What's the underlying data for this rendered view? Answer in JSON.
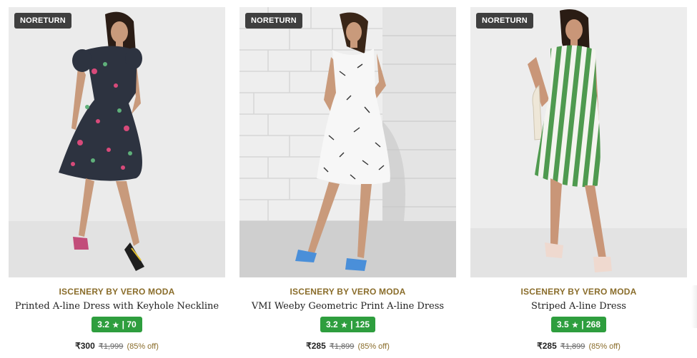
{
  "products": [
    {
      "badge": "NORETURN",
      "brand": "ISCENERY BY VERO MODA",
      "name": "Printed A-line Dress with Keyhole Neckline",
      "rating": "3.2",
      "rating_star": "★",
      "rating_count": "70",
      "price": "₹300",
      "mrp": "₹1,999",
      "discount": "(85% off)"
    },
    {
      "badge": "NORETURN",
      "brand": "ISCENERY BY VERO MODA",
      "name": "VMI Weeby Geometric Print A-line Dress",
      "rating": "3.2",
      "rating_star": "★",
      "rating_count": "125",
      "price": "₹285",
      "mrp": "₹1,899",
      "discount": "(85% off)"
    },
    {
      "badge": "NORETURN",
      "brand": "ISCENERY BY VERO MODA",
      "name": "Striped A-line Dress",
      "rating": "3.5",
      "rating_star": "★",
      "rating_count": "268",
      "price": "₹285",
      "mrp": "₹1,899",
      "discount": "(85% off)"
    }
  ],
  "colors": {
    "brand_text": "#8a6d2b",
    "rating_badge": "#2e9e3e",
    "badge_bg": "#3f3f3f"
  }
}
